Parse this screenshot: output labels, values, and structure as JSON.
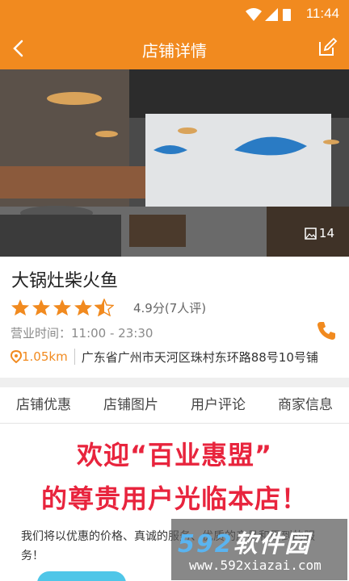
{
  "status_bar": {
    "time": "11:44"
  },
  "header": {
    "title": "店铺详情"
  },
  "hero": {
    "photo_count": "14"
  },
  "store": {
    "name": "大锅灶柴火鱼",
    "rating_value": 4.5,
    "rating_text": "4.9分(7人评)",
    "hours": "营业时间：11:00 - 23:30",
    "distance": "1.05km",
    "address": "广东省广州市天河区珠村东环路88号10号铺"
  },
  "tabs": [
    {
      "label": "店铺优惠"
    },
    {
      "label": "店铺图片"
    },
    {
      "label": "用户评论"
    },
    {
      "label": "商家信息"
    }
  ],
  "promo": {
    "line1": "欢迎“百业惠盟”",
    "line2": "的尊贵用户光临本店！",
    "description": "我们将以优惠的价格、真诚的服务、优质的产品和周到的服务！"
  },
  "watermark": {
    "top": "软件园",
    "top_num": "592",
    "bottom": "www.592xiazai.com"
  },
  "colors": {
    "accent": "#f18a1f",
    "promo_red": "#e8243d"
  }
}
